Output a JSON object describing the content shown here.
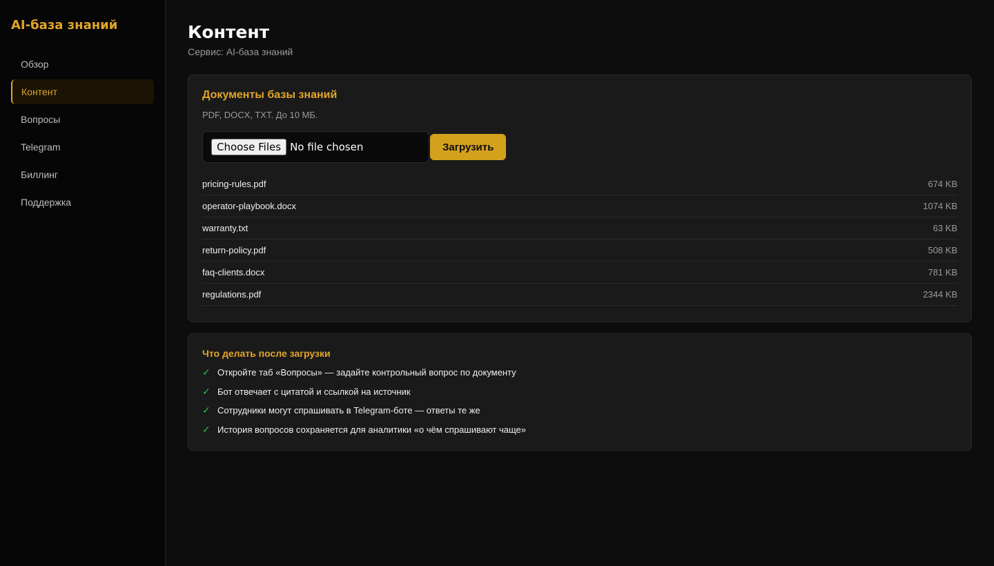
{
  "sidebar": {
    "brand": "AI-база знаний",
    "items": [
      {
        "label": "Обзор",
        "active": false
      },
      {
        "label": "Контент",
        "active": true
      },
      {
        "label": "Вопросы",
        "active": false
      },
      {
        "label": "Telegram",
        "active": false
      },
      {
        "label": "Биллинг",
        "active": false
      },
      {
        "label": "Поддержка",
        "active": false
      }
    ]
  },
  "header": {
    "title": "Контент",
    "subtitle": "Сервис: AI-база знаний"
  },
  "documents": {
    "title": "Документы базы знаний",
    "note": "PDF, DOCX, TXT. До 10 МБ.",
    "file_input": {
      "button_label": "Choose Files",
      "status": "No file chosen"
    },
    "upload_label": "Загрузить",
    "files": [
      {
        "name": "pricing-rules.pdf",
        "size": "674 KB"
      },
      {
        "name": "operator-playbook.docx",
        "size": "1074 KB"
      },
      {
        "name": "warranty.txt",
        "size": "63 KB"
      },
      {
        "name": "return-policy.pdf",
        "size": "508 KB"
      },
      {
        "name": "faq-clients.docx",
        "size": "781 KB"
      },
      {
        "name": "regulations.pdf",
        "size": "2344 KB"
      }
    ]
  },
  "next_steps": {
    "title": "Что делать после загрузки",
    "check_glyph": "✓",
    "items": [
      "Откройте таб «Вопросы» — задайте контрольный вопрос по документу",
      "Бот отвечает с цитатой и ссылкой на источник",
      "Сотрудники могут спрашивать в Telegram-боте — ответы те же",
      "История вопросов сохраняется для аналитики «о чём спрашивают чаще»"
    ]
  },
  "colors": {
    "accent": "#e3a62a",
    "button": "#d4a11c",
    "check": "#2fbf52"
  }
}
